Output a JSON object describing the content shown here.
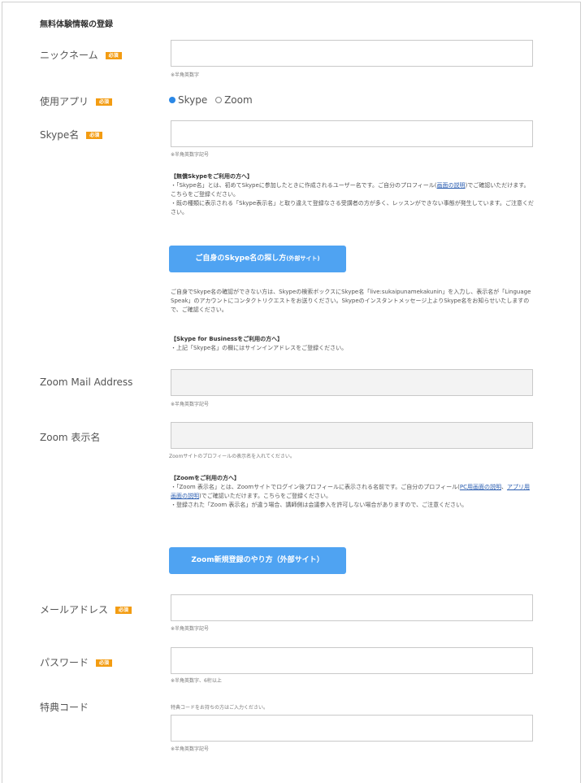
{
  "page": {
    "title": "無料体験情報の登録"
  },
  "common": {
    "required": "必須"
  },
  "nickname": {
    "label": "ニックネーム",
    "hint": "※半角英数字"
  },
  "app": {
    "label": "使用アプリ",
    "options": [
      "Skype",
      "Zoom"
    ],
    "selected": "Skype"
  },
  "skype": {
    "label": "Skype名",
    "hint": "※半角英数字記号",
    "note_heading": "【無償Skypeをご利用の方へ】",
    "note_lines": [
      "・「Skype名」とは、初めてSkypeに参加したときに作成されるユーザー名です。ご自分のプロフィール(",
      "画面の説明",
      ")でご確認いただけます。こちらをご登録ください。",
      "・既の種類に表示される「Skype表示名」と取り違えて登録なさる受講者の方が多く、レッスンができない事態が発生しています。ご注意ください。"
    ],
    "button": "ご自身のSkype名の探し方",
    "button_sub": "(外部サイト)",
    "after_text": "ご自身でSkype名の確認ができない方は、Skypeの検索ボックスにSkype名「live:sukaipunamekakunin」を入力し、表示名が「Linguage Speak」のアカウントにコンタクトリクエストをお送りください。Skypeのインスタントメッセージ上よりSkype名をお知らせいたしますので、ご確認ください。",
    "business_heading": "【Skype for Businessをご利用の方へ】",
    "business_text": "・上記「Skype名」の欄にはサインインアドレスをご登録ください。"
  },
  "zoom_mail": {
    "label": "Zoom Mail Address",
    "hint": "※半角英数字記号"
  },
  "zoom_name": {
    "label": "Zoom 表示名",
    "hint": "Zoomサイトのプロフィールの表示名を入れてください。",
    "note_heading": "【Zoomをご利用の方へ】",
    "note_line1": "・「Zoom 表示名」とは、Zoomサイトでログイン後プロフィールに表示される名前です。ご自分のプロフィール(",
    "note_link1": "PC用画面の説明",
    "note_sep": "、",
    "note_link2": "アプリ用画面の説明",
    "note_line1_end": ")でご確認いただけます。こちらをご登録ください。",
    "note_line2": "・登録された「Zoom 表示名」が違う場合、講師側は会議参入を許可しない場合がありますので、ご注意ください。",
    "button": "Zoom新規登録のやり方（外部サイト）"
  },
  "email": {
    "label": "メールアドレス",
    "hint": "※半角英数字記号"
  },
  "password": {
    "label": "パスワード",
    "hint": "※半角英数字、6桁以上"
  },
  "promo": {
    "label": "特典コード",
    "hint_top": "特典コードをお持ちの方はご入力ください。",
    "hint": "※半角英数字記号"
  }
}
